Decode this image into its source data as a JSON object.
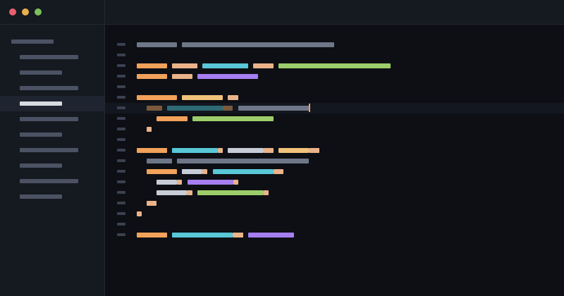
{
  "window": {
    "traffic_lights": {
      "close_color": "#e8606f",
      "minimize_color": "#e8b04c",
      "maximize_color": "#7dbf5a"
    }
  },
  "theme": {
    "background": "#0d0f14",
    "sidebar_background": "#151920",
    "active_row_background": "#1e2430",
    "current_line_background": "#131720",
    "caret_color": "#f0a050",
    "colors": {
      "orange": "#f2a25a",
      "peach": "#eab38a",
      "cyan": "#58c7d6",
      "green": "#9ccd6a",
      "purple": "#a57ef0",
      "yellow": "#f0c27a",
      "gray": "#6e7788",
      "light": "#c7ccd6",
      "brown": "#7b5a3c",
      "teal": "#2e6a73",
      "dim": "#3a4150",
      "sidebar_text": "#4b5263",
      "sidebar_text_active": "#d7dbe2"
    }
  },
  "sidebar": {
    "items": [
      {
        "kind": "folder",
        "active": false
      },
      {
        "kind": "file",
        "active": false
      },
      {
        "kind": "file",
        "active": false
      },
      {
        "kind": "file",
        "active": false
      },
      {
        "kind": "file",
        "active": true
      },
      {
        "kind": "file",
        "active": false
      },
      {
        "kind": "file",
        "active": false
      },
      {
        "kind": "file",
        "active": false
      },
      {
        "kind": "file",
        "active": false
      },
      {
        "kind": "file",
        "active": false
      },
      {
        "kind": "file",
        "active": false
      }
    ]
  },
  "editor": {
    "current_line": 7,
    "line_count": 19
  }
}
